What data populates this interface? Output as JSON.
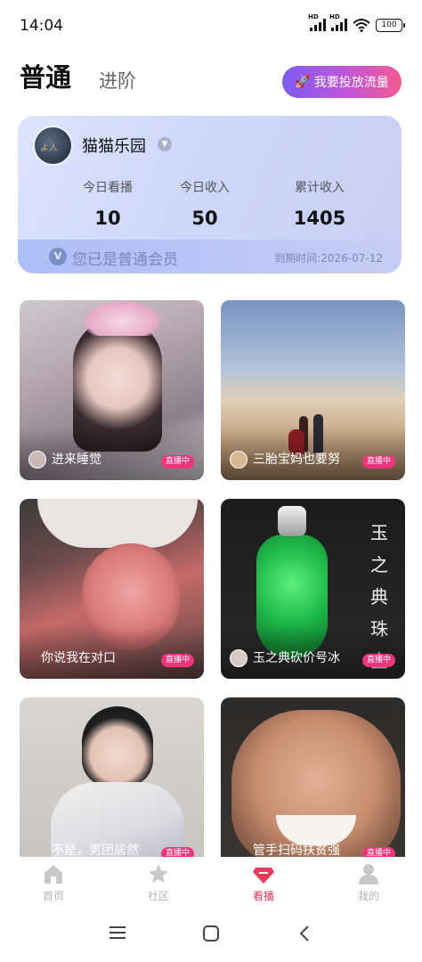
{
  "status_bar": {
    "time": "14:04",
    "network1": "HD",
    "network2": "HD",
    "battery": "100"
  },
  "header": {
    "tab_primary": "普通",
    "tab_secondary": "进阶",
    "promo_button": "我要投放流量"
  },
  "member_card": {
    "name": "猫猫乐园",
    "avatar_text": "よ人",
    "stats": [
      {
        "label": "今日看播",
        "value": "10"
      },
      {
        "label": "今日收入",
        "value": "50"
      },
      {
        "label": "累计收入",
        "value": "1405"
      }
    ],
    "vip_badge": "V",
    "status": "您已是普通会员",
    "expire": "到期时间:2026-07-12"
  },
  "live_rooms": [
    {
      "title": "进来睡觉",
      "badge": "直播中"
    },
    {
      "title": "三胎宝妈也要努",
      "badge": "直播中"
    },
    {
      "title": "你说我在对口",
      "badge": "直播中"
    },
    {
      "title": "玉之典砍价号冰",
      "badge": "直播中",
      "overlay": "玉之典珠宝"
    },
    {
      "title": "不是，男团居然",
      "badge": "直播中"
    },
    {
      "title": "管手扫码扶贫强",
      "badge": "直播中"
    }
  ],
  "bottom_nav": [
    {
      "label": "首页",
      "icon": "home-icon",
      "active": false
    },
    {
      "label": "社区",
      "icon": "star-icon",
      "active": false
    },
    {
      "label": "看播",
      "icon": "diamond-icon",
      "active": true
    },
    {
      "label": "我的",
      "icon": "profile-icon",
      "active": false
    }
  ],
  "colors": {
    "accent": "#f0395a",
    "live_badge": "#f0347c",
    "promo_start": "#7c5cf0",
    "promo_end": "#f45a8d"
  }
}
